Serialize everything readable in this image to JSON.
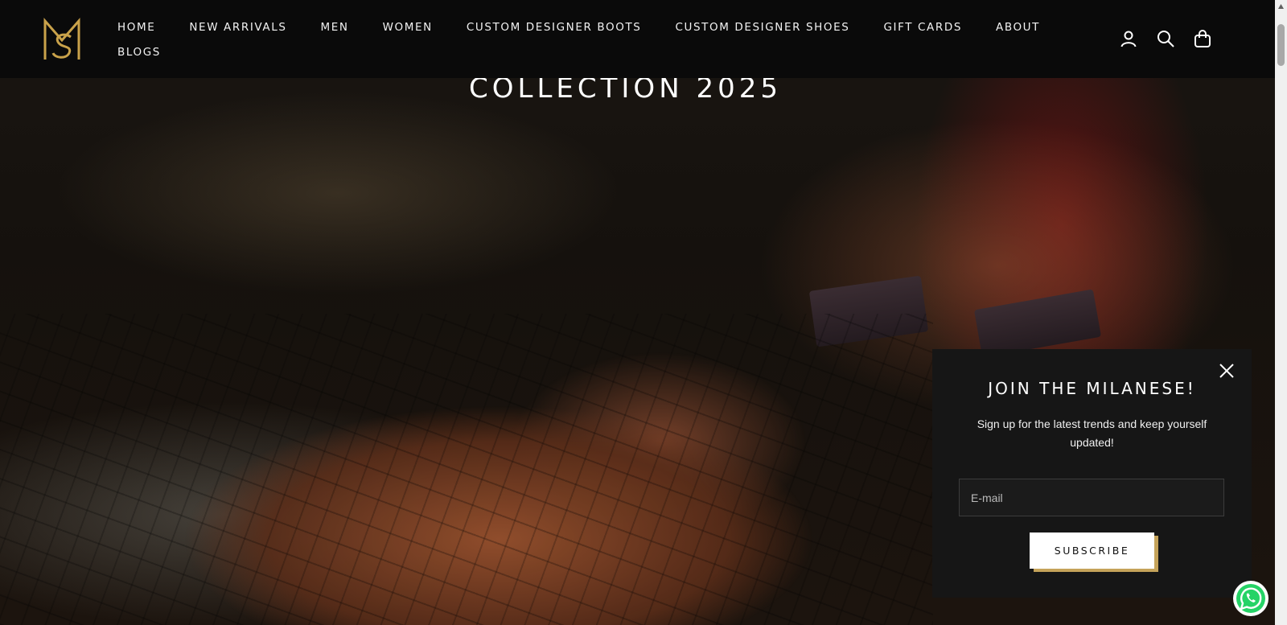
{
  "brand": {
    "logo_letters": "MS",
    "logo_color": "#c9a24a"
  },
  "nav": {
    "items": [
      {
        "label": "HOME"
      },
      {
        "label": "NEW ARRIVALS"
      },
      {
        "label": "MEN"
      },
      {
        "label": "WOMEN"
      },
      {
        "label": "CUSTOM DESIGNER BOOTS"
      },
      {
        "label": "CUSTOM DESIGNER SHOES"
      },
      {
        "label": "GIFT CARDS"
      },
      {
        "label": "ABOUT"
      },
      {
        "label": "BLOGS"
      }
    ]
  },
  "header_icons": [
    "account-icon",
    "search-icon",
    "cart-bag-icon"
  ],
  "hero": {
    "title": "COLLECTION 2025"
  },
  "popup": {
    "title": "JOIN THE MILANESE!",
    "text": "Sign up for the latest trends and keep yourself updated!",
    "email_placeholder": "E-mail",
    "email_value": "",
    "subscribe_label": "SUBSCRIBE",
    "accent": "#c5a35a"
  },
  "whatsapp": {
    "icon": "whatsapp-icon",
    "color": "#25d366"
  }
}
